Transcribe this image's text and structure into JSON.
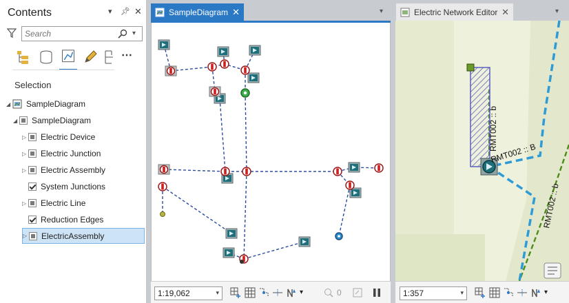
{
  "contents": {
    "title": "Contents",
    "search_placeholder": "Search",
    "section_label": "Selection",
    "tree": [
      {
        "label": "SampleDiagram",
        "level": 0,
        "expanded": true,
        "icon": "map-icon"
      },
      {
        "label": "SampleDiagram",
        "level": 1,
        "expanded": true,
        "state": "partial"
      },
      {
        "label": "Electric Device",
        "level": 2,
        "expanded": false,
        "state": "partial"
      },
      {
        "label": "Electric Junction",
        "level": 2,
        "expanded": false,
        "state": "partial"
      },
      {
        "label": "Electric Assembly",
        "level": 2,
        "expanded": false,
        "state": "partial"
      },
      {
        "label": "System Junctions",
        "level": 2,
        "state": "checked"
      },
      {
        "label": "Electric Line",
        "level": 2,
        "expanded": false,
        "state": "partial"
      },
      {
        "label": "Reduction Edges",
        "level": 2,
        "state": "checked"
      },
      {
        "label": "ElectricAssembly",
        "level": 2,
        "expanded": false,
        "state": "partial",
        "selected": true
      }
    ]
  },
  "diagram_view": {
    "tab_label": "SampleDiagram",
    "scale": "1:19,062",
    "zero_count": "0"
  },
  "editor_view": {
    "tab_label": "Electric Network Editor",
    "scale": "1:357",
    "map_labels": [
      "RMT002 :: b",
      "RMT002 :: B",
      "RMT002 :: b"
    ]
  },
  "colors": {
    "accent": "#2b78c5",
    "edge_blue": "#2a4b9f",
    "device_teal": "#1f6f7a",
    "map_blue_line": "#2f9bd6",
    "map_green_line": "#4d8a1c"
  }
}
